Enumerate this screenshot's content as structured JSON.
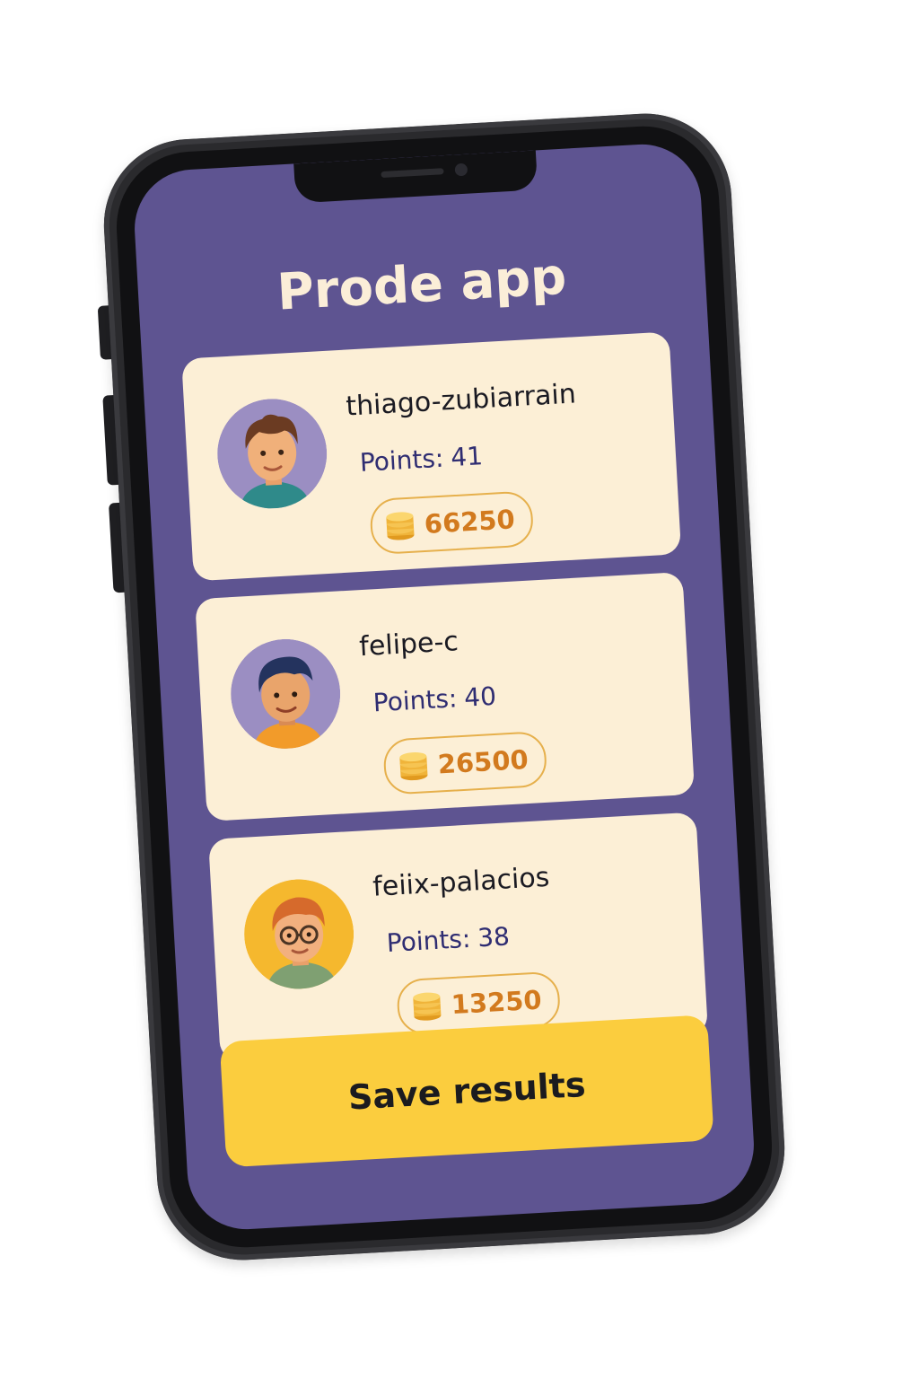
{
  "app": {
    "title": "Prode app"
  },
  "players": [
    {
      "username": "thiago-zubiarrain",
      "points_label": "Points:",
      "points": "41",
      "coins": "66250",
      "avatar": "avatar-boy-brown-curly-hair-teal-shirt"
    },
    {
      "username": "felipe-c",
      "points_label": "Points:",
      "points": "40",
      "coins": "26500",
      "avatar": "avatar-boy-dark-blue-hair-orange-shirt"
    },
    {
      "username": "feiix-palacios",
      "points_label": "Points:",
      "points": "38",
      "coins": "13250",
      "avatar": "avatar-boy-red-hair-glasses-green-shirt"
    }
  ],
  "actions": {
    "save_label": "Save results"
  },
  "icons": {
    "coin": "coin-stack-icon"
  },
  "colors": {
    "screen_bg": "#5e5491",
    "card_bg": "#fcefd6",
    "title_text": "#fbeed8",
    "points_text": "#2f2d72",
    "coins_text": "#d27a1e",
    "save_button": "#fbcd3e"
  }
}
